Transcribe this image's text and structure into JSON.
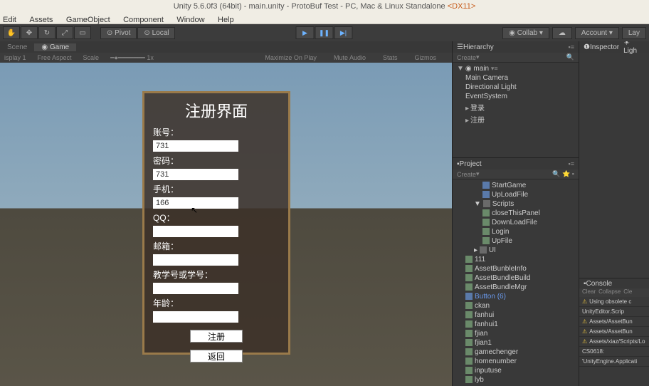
{
  "title": {
    "prefix": "Unity 5.6.0f3 (64bit) - main.unity - ProtoBuf Test - PC, Mac & Linux Standalone ",
    "suffix": "<DX11>"
  },
  "menu": [
    "Edit",
    "Assets",
    "GameObject",
    "Component",
    "Window",
    "Help"
  ],
  "toolbar": {
    "pivot": "Pivot",
    "local": "Local",
    "collab": "Collab",
    "account": "Account",
    "layers": "Lay"
  },
  "gameTabs": {
    "scene": "Scene",
    "game": "Game"
  },
  "gameBar": {
    "display": "isplay 1",
    "aspect": "Free Aspect",
    "scale": "Scale",
    "scaleVal": "1x",
    "maximize": "Maximize On Play",
    "mute": "Mute Audio",
    "stats": "Stats",
    "gizmos": "Gizmos"
  },
  "reg": {
    "title": "注册界面",
    "account": "账号：",
    "accountVal": "731",
    "password": "密码：",
    "passwordVal": "731",
    "phone": "手机：",
    "phoneVal": "166",
    "qq": "QQ：",
    "qqVal": "",
    "email": "邮箱：",
    "emailVal": "",
    "studentId": "教学号或学号：",
    "studentVal": "",
    "age": "年龄：",
    "ageVal": "",
    "submit": "注册",
    "back": "返回"
  },
  "hierarchy": {
    "title": "Hierarchy",
    "create": "Create",
    "scene": "main",
    "items": [
      "Main Camera",
      "Directional Light",
      "EventSystem",
      "登录",
      "注册"
    ]
  },
  "project": {
    "title": "Project",
    "create": "Create",
    "items": [
      {
        "name": "StartGame",
        "type": "prefab",
        "ind": 3
      },
      {
        "name": "UpLoadFile",
        "type": "prefab",
        "ind": 3
      },
      {
        "name": "Scripts",
        "type": "folder",
        "ind": 2,
        "open": true
      },
      {
        "name": "closeThisPanel",
        "type": "cs",
        "ind": 3
      },
      {
        "name": "DownLoadFile",
        "type": "cs",
        "ind": 3
      },
      {
        "name": "Login",
        "type": "cs",
        "ind": 3
      },
      {
        "name": "UpFile",
        "type": "cs",
        "ind": 3
      },
      {
        "name": "UI",
        "type": "folder",
        "ind": 2
      },
      {
        "name": "111",
        "type": "file",
        "ind": 1
      },
      {
        "name": "AssetBunbleInfo",
        "type": "cs",
        "ind": 1
      },
      {
        "name": "AssetBundleBuild",
        "type": "cs",
        "ind": 1
      },
      {
        "name": "AssetBundleMgr",
        "type": "cs",
        "ind": 1
      },
      {
        "name": "Button (6)",
        "type": "prefab",
        "ind": 1,
        "blue": true
      },
      {
        "name": "ckan",
        "type": "cs",
        "ind": 1
      },
      {
        "name": "fanhui",
        "type": "cs",
        "ind": 1
      },
      {
        "name": "fanhui1",
        "type": "cs",
        "ind": 1
      },
      {
        "name": "fjian",
        "type": "cs",
        "ind": 1
      },
      {
        "name": "fjian1",
        "type": "cs",
        "ind": 1
      },
      {
        "name": "gamechenger",
        "type": "cs",
        "ind": 1
      },
      {
        "name": "homenumber",
        "type": "cs",
        "ind": 1
      },
      {
        "name": "inputuse",
        "type": "cs",
        "ind": 1
      },
      {
        "name": "lyb",
        "type": "cs",
        "ind": 1
      }
    ]
  },
  "inspector": {
    "title": "Inspector",
    "light": "Ligh"
  },
  "console": {
    "title": "Console",
    "clear": "Clear",
    "collapse": "Collapse",
    "cle": "Cle",
    "lines": [
      "Using obsolete c",
      "UnityEditor.Scrip",
      "Assets/AssetBun",
      "Assets/AssetBun",
      "Assets/xiaz/Scripts/Lo",
      "CS0618:",
      "'UnityEngine.Applicati"
    ]
  }
}
